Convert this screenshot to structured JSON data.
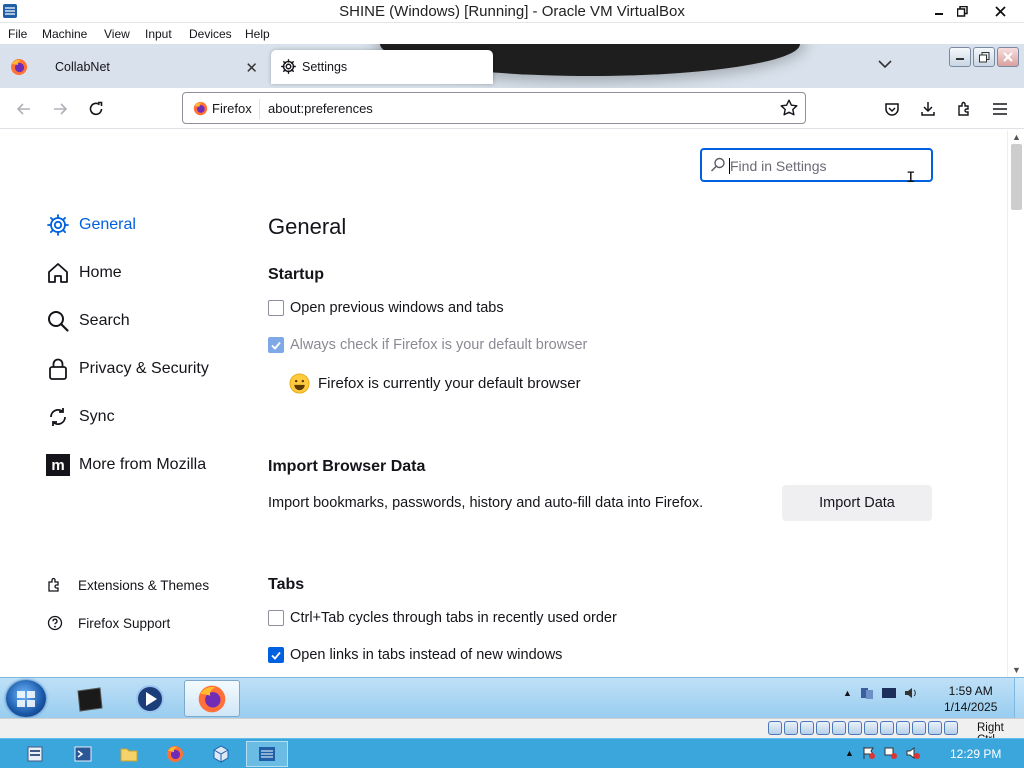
{
  "vbox": {
    "title": "SHINE (Windows) [Running] - Oracle VM VirtualBox",
    "menu": [
      "File",
      "Machine",
      "View",
      "Input",
      "Devices",
      "Help"
    ],
    "status_hostkey": "Right Ctrl"
  },
  "browser": {
    "tabs": [
      {
        "label": "CollabNet",
        "icon": "firefox-icon",
        "active": false
      },
      {
        "label": "Settings",
        "icon": "gear-icon",
        "active": true
      }
    ],
    "urlbar": {
      "identity": "Firefox",
      "url": "about:preferences"
    }
  },
  "settings": {
    "search": {
      "placeholder": "Find in Settings",
      "value": ""
    },
    "categories": [
      {
        "label": "General",
        "icon": "gear-icon",
        "selected": true
      },
      {
        "label": "Home",
        "icon": "home-icon"
      },
      {
        "label": "Search",
        "icon": "search-icon"
      },
      {
        "label": "Privacy & Security",
        "icon": "lock-icon"
      },
      {
        "label": "Sync",
        "icon": "sync-icon"
      },
      {
        "label": "More from Mozilla",
        "icon": "mozilla-icon"
      }
    ],
    "footer": [
      {
        "label": "Extensions & Themes",
        "icon": "puzzle-icon"
      },
      {
        "label": "Firefox Support",
        "icon": "help-icon"
      }
    ],
    "pane_title": "General",
    "startup": {
      "heading": "Startup",
      "open_previous": {
        "label": "Open previous windows and tabs",
        "checked": false
      },
      "always_check": {
        "label": "Always check if Firefox is your default browser",
        "checked": true,
        "disabled": true
      },
      "default_status": "Firefox is currently your default browser"
    },
    "import": {
      "heading": "Import Browser Data",
      "description": "Import bookmarks, passwords, history and auto-fill data into Firefox.",
      "button": "Import Data"
    },
    "tabs_section": {
      "heading": "Tabs",
      "ctrl_tab": {
        "label": "Ctrl+Tab cycles through tabs in recently used order",
        "checked": false
      },
      "open_links": {
        "label": "Open links in tabs instead of new windows",
        "checked": true
      }
    }
  },
  "guest_taskbar": {
    "clock_time": "1:59 AM",
    "clock_date": "1/14/2025"
  },
  "host_taskbar": {
    "clock": "12:29 PM"
  },
  "colors": {
    "accent": "#0061e0",
    "tabbar": "#d9e2ec",
    "guest_taskbar": "#98cdef",
    "host_taskbar": "#3aa6dc"
  }
}
